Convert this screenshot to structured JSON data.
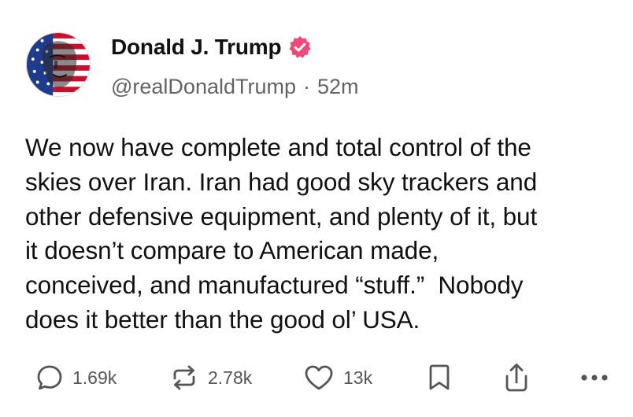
{
  "author": {
    "display_name": "Donald J. Trump",
    "handle": "@realDonaldTrump",
    "separator": "·",
    "time_ago": "52m",
    "verified": true,
    "verified_color": "#f0487a"
  },
  "post": {
    "lines": [
      "We now have complete and total control of the",
      "skies over Iran. Iran had good sky trackers and",
      "other defensive equipment, and plenty of it, but",
      "it doesn’t compare to American made,",
      "conceived, and manufactured “stuff.”  Nobody",
      "does it better than the good ol’ USA."
    ]
  },
  "actions": {
    "reply": {
      "icon": "speech-bubble-icon",
      "count": "1.69k"
    },
    "repost": {
      "icon": "repost-arrows-icon",
      "count": "2.78k"
    },
    "like": {
      "icon": "heart-icon",
      "count": "13k"
    },
    "save": {
      "icon": "bookmark-icon"
    },
    "share": {
      "icon": "share-upload-icon"
    },
    "more": {
      "icon": "ellipsis-icon"
    }
  },
  "colors": {
    "text": "#111111",
    "muted": "#636363",
    "icon": "#555555"
  }
}
